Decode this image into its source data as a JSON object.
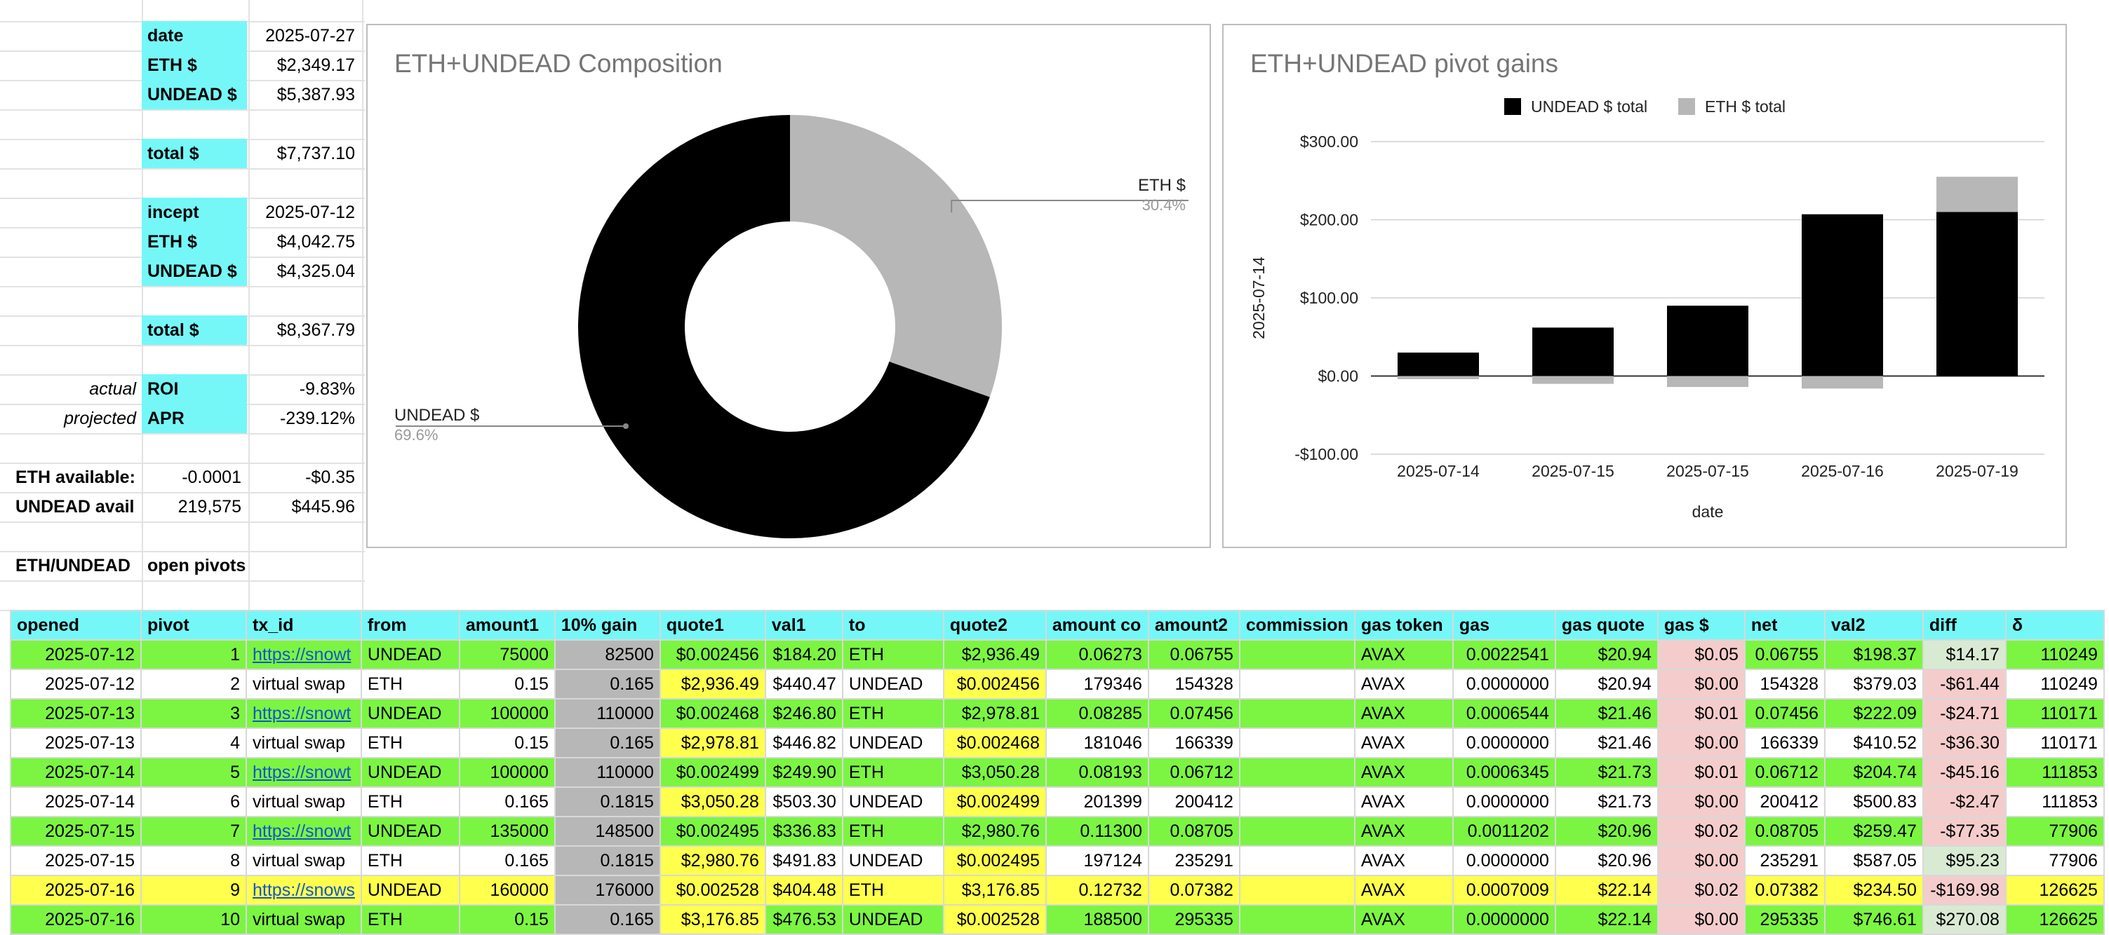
{
  "summary": {
    "date_label": "date",
    "date_value": "2025-07-27",
    "eth_label": "ETH $",
    "eth_value": "$2,349.17",
    "undead_label": "UNDEAD $",
    "undead_value": "$5,387.93",
    "total_label": "total $",
    "total_value": "$7,737.10",
    "incept_label": "incept",
    "incept_value": "2025-07-12",
    "incept_eth_label": "ETH $",
    "incept_eth_value": "$4,042.75",
    "incept_undead_label": "UNDEAD $",
    "incept_undead_value": "$4,325.04",
    "incept_total_label": "total $",
    "incept_total_value": "$8,367.79",
    "actual_label": "actual",
    "roi_label": "ROI",
    "roi_value": "-9.83%",
    "projected_label": "projected",
    "apr_label": "APR",
    "apr_value": "-239.12%",
    "eth_avail_label": "ETH available:",
    "eth_avail_qty": "-0.0001",
    "eth_avail_usd": "-$0.35",
    "undead_avail_label": "UNDEAD avail",
    "undead_avail_qty": "219,575",
    "undead_avail_usd": "$445.96",
    "pivots_label": "ETH/UNDEAD",
    "pivots_sub": "open pivots"
  },
  "chart_data": [
    {
      "type": "pie",
      "title": "ETH+UNDEAD Composition",
      "slices": [
        {
          "name": "ETH $",
          "value": 30.4,
          "label": "30.4%",
          "color": "#b7b7b7"
        },
        {
          "name": "UNDEAD $",
          "value": 69.6,
          "label": "69.6%",
          "color": "#000000"
        }
      ],
      "donut": true
    },
    {
      "type": "bar",
      "title": "ETH+UNDEAD pivot gains",
      "stacked": true,
      "categories": [
        "2025-07-14",
        "2025-07-15",
        "2025-07-15",
        "2025-07-16",
        "2025-07-19"
      ],
      "series": [
        {
          "name": "UNDEAD $ total",
          "color": "#000000",
          "values": [
            30,
            62,
            90,
            207,
            210
          ]
        },
        {
          "name": "ETH $ total",
          "color": "#b7b7b7",
          "values": [
            -4,
            -10,
            -14,
            -16,
            45
          ]
        }
      ],
      "xlabel": "date",
      "ylabel": "2025-07-14",
      "ylim": [
        -100,
        300
      ],
      "yticks": [
        "$300.00",
        "$200.00",
        "$100.00",
        "$0.00",
        "-$100.00"
      ],
      "legend": "top"
    }
  ],
  "table": {
    "headers": [
      "opened",
      "pivot",
      "tx_id",
      "from",
      "amount1",
      "10% gain",
      "quote1",
      "val1",
      "to",
      "quote2",
      "amount co",
      "amount2",
      "commission",
      "gas token",
      "gas",
      "gas quote",
      "gas $",
      "net",
      "val2",
      "diff",
      "δ"
    ],
    "rows": [
      {
        "style": "g",
        "cells": [
          "2025-07-12",
          "1",
          "https://snowt",
          "UNDEAD",
          "75000",
          "82500",
          "$0.002456",
          "$184.20",
          "ETH",
          "$2,936.49",
          "0.06273",
          "0.06755",
          "",
          "AVAX",
          "0.0022541",
          "$20.94",
          "$0.05",
          "0.06755",
          "$198.37",
          "$14.17",
          "110249"
        ]
      },
      {
        "style": "w",
        "cells": [
          "2025-07-12",
          "2",
          "virtual swap",
          "ETH",
          "0.15",
          "0.165",
          "$2,936.49",
          "$440.47",
          "UNDEAD",
          "$0.002456",
          "179346",
          "154328",
          "",
          "AVAX",
          "0.0000000",
          "$20.94",
          "$0.00",
          "154328",
          "$379.03",
          "-$61.44",
          "110249"
        ]
      },
      {
        "style": "g",
        "cells": [
          "2025-07-13",
          "3",
          "https://snowt",
          "UNDEAD",
          "100000",
          "110000",
          "$0.002468",
          "$246.80",
          "ETH",
          "$2,978.81",
          "0.08285",
          "0.07456",
          "",
          "AVAX",
          "0.0006544",
          "$21.46",
          "$0.01",
          "0.07456",
          "$222.09",
          "-$24.71",
          "110171"
        ]
      },
      {
        "style": "w",
        "cells": [
          "2025-07-13",
          "4",
          "virtual swap",
          "ETH",
          "0.15",
          "0.165",
          "$2,978.81",
          "$446.82",
          "UNDEAD",
          "$0.002468",
          "181046",
          "166339",
          "",
          "AVAX",
          "0.0000000",
          "$21.46",
          "$0.00",
          "166339",
          "$410.52",
          "-$36.30",
          "110171"
        ]
      },
      {
        "style": "g",
        "cells": [
          "2025-07-14",
          "5",
          "https://snowt",
          "UNDEAD",
          "100000",
          "110000",
          "$0.002499",
          "$249.90",
          "ETH",
          "$3,050.28",
          "0.08193",
          "0.06712",
          "",
          "AVAX",
          "0.0006345",
          "$21.73",
          "$0.01",
          "0.06712",
          "$204.74",
          "-$45.16",
          "111853"
        ]
      },
      {
        "style": "w",
        "cells": [
          "2025-07-14",
          "6",
          "virtual swap",
          "ETH",
          "0.165",
          "0.1815",
          "$3,050.28",
          "$503.30",
          "UNDEAD",
          "$0.002499",
          "201399",
          "200412",
          "",
          "AVAX",
          "0.0000000",
          "$21.73",
          "$0.00",
          "200412",
          "$500.83",
          "-$2.47",
          "111853"
        ]
      },
      {
        "style": "g",
        "cells": [
          "2025-07-15",
          "7",
          "https://snowt",
          "UNDEAD",
          "135000",
          "148500",
          "$0.002495",
          "$336.83",
          "ETH",
          "$2,980.76",
          "0.11300",
          "0.08705",
          "",
          "AVAX",
          "0.0011202",
          "$20.96",
          "$0.02",
          "0.08705",
          "$259.47",
          "-$77.35",
          "77906"
        ]
      },
      {
        "style": "w",
        "cells": [
          "2025-07-15",
          "8",
          "virtual swap",
          "ETH",
          "0.165",
          "0.1815",
          "$2,980.76",
          "$491.83",
          "UNDEAD",
          "$0.002495",
          "197124",
          "235291",
          "",
          "AVAX",
          "0.0000000",
          "$20.96",
          "$0.00",
          "235291",
          "$587.05",
          "$95.23",
          "77906"
        ]
      },
      {
        "style": "y",
        "cells": [
          "2025-07-16",
          "9",
          "https://snows",
          "UNDEAD",
          "160000",
          "176000",
          "$0.002528",
          "$404.48",
          "ETH",
          "$3,176.85",
          "0.12732",
          "0.07382",
          "",
          "AVAX",
          "0.0007009",
          "$22.14",
          "$0.02",
          "0.07382",
          "$234.50",
          "-$169.98",
          "126625"
        ]
      },
      {
        "style": "g",
        "cells": [
          "2025-07-16",
          "10",
          "virtual swap",
          "ETH",
          "0.15",
          "0.165",
          "$3,176.85",
          "$476.53",
          "UNDEAD",
          "$0.002528",
          "188500",
          "295335",
          "",
          "AVAX",
          "0.0000000",
          "$22.14",
          "$0.00",
          "295335",
          "$746.61",
          "$270.08",
          "126625"
        ]
      }
    ]
  }
}
